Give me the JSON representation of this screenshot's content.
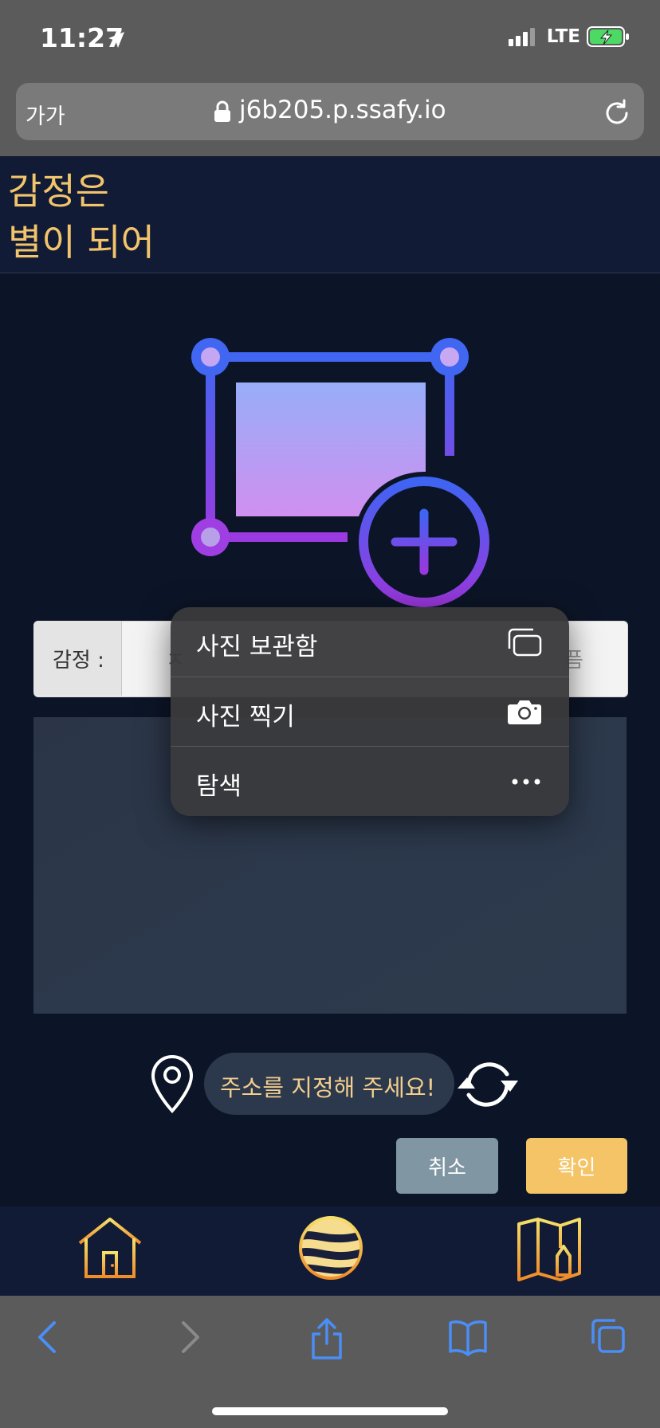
{
  "status_bar": {
    "time": "11:27",
    "network": "LTE"
  },
  "browser": {
    "text_size_label": "가가",
    "url": "j6b205.p.ssafy.io"
  },
  "header": {
    "title_line1": "감정은",
    "title_line2": "별이 되어"
  },
  "emotion_select": {
    "label": "감정 :",
    "peek_left": "ㅈ",
    "peek_right": "픔"
  },
  "context_menu": {
    "items": [
      {
        "label": "사진 보관함",
        "icon": "photo-library-icon"
      },
      {
        "label": "사진 찍기",
        "icon": "camera-icon"
      },
      {
        "label": "탐색",
        "icon": "ellipsis-icon"
      }
    ]
  },
  "address": {
    "placeholder": "주소를 지정해 주세요!"
  },
  "buttons": {
    "cancel": "취소",
    "confirm": "확인"
  },
  "colors": {
    "accent": "#f4c466",
    "cancel": "#8096a2",
    "header_bg": "#121b36",
    "page_bg": "#0c1527"
  }
}
